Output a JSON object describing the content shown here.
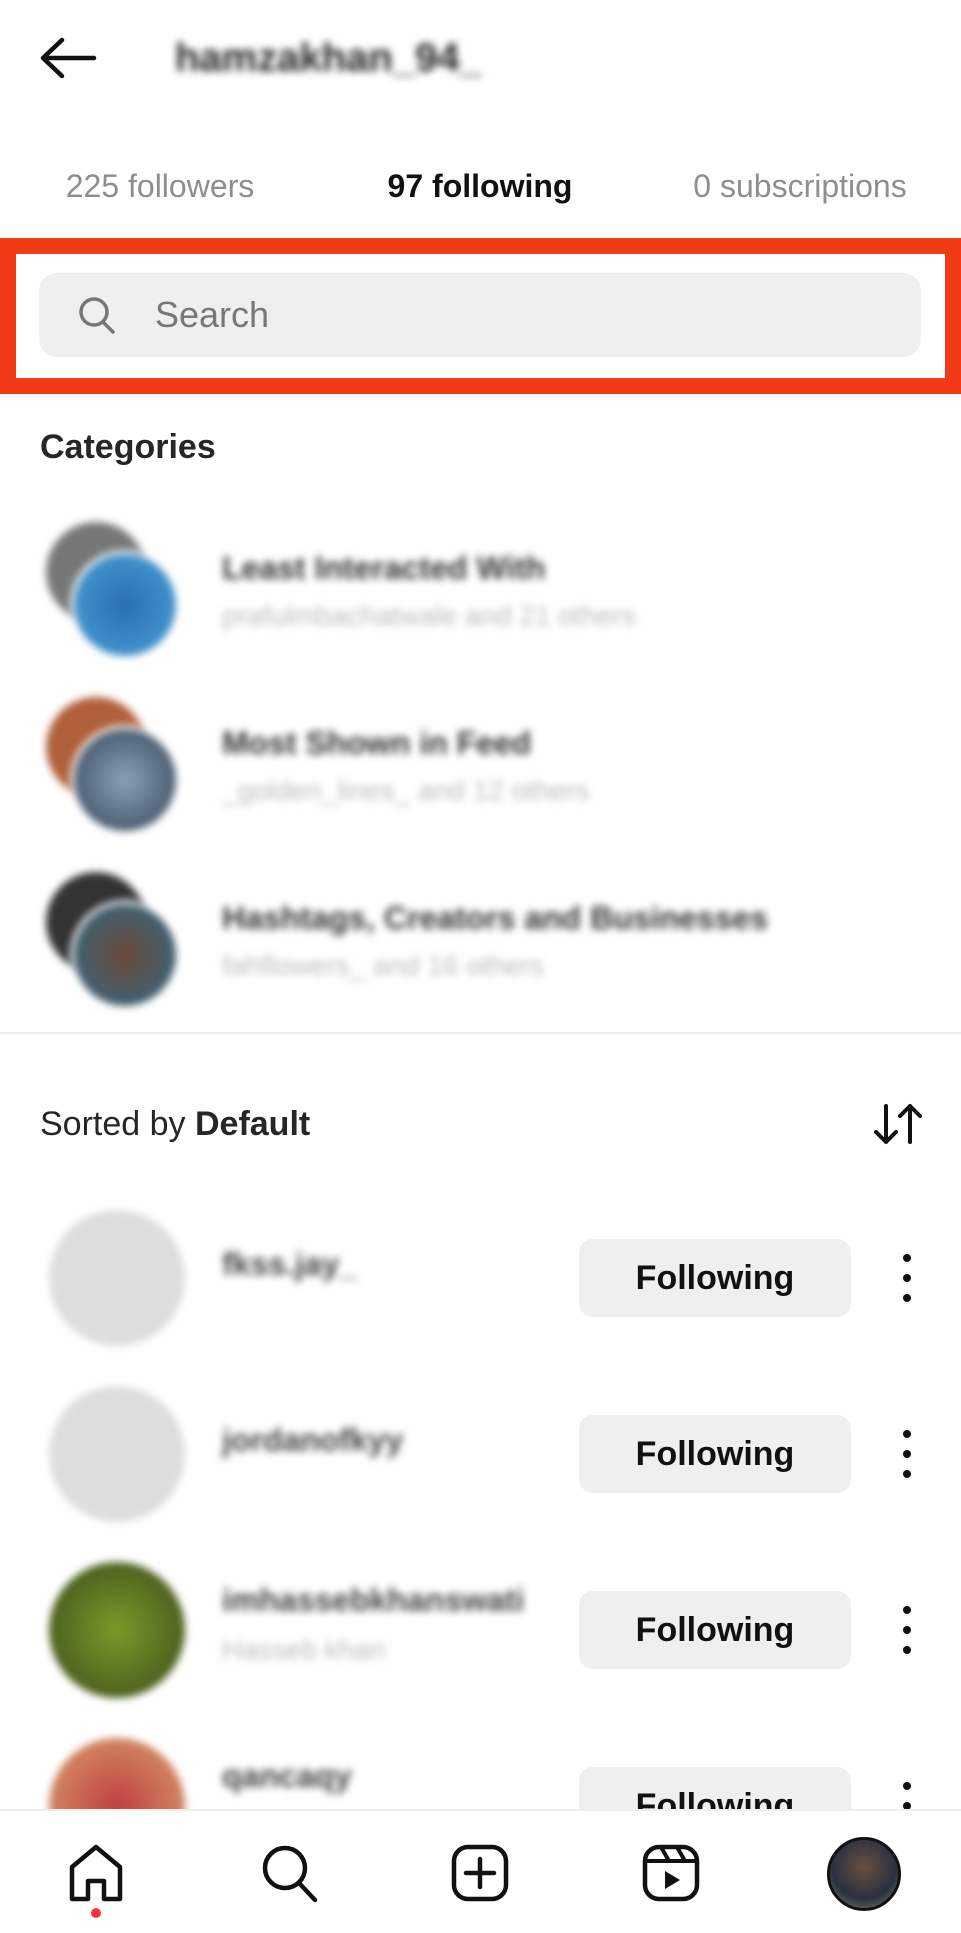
{
  "header": {
    "title": "hamzakhan_94_"
  },
  "tabs": [
    {
      "label": "225 followers",
      "active": false
    },
    {
      "label": "97 following",
      "active": true
    },
    {
      "label": "0 subscriptions",
      "active": false
    }
  ],
  "search": {
    "placeholder": "Search",
    "highlight_color": "#f23a18"
  },
  "categories": {
    "heading": "Categories",
    "items": [
      {
        "title": "Least Interacted With",
        "subtitle": "prafulmbachatwale and 21 others"
      },
      {
        "title": "Most Shown in Feed",
        "subtitle": "_golden_lines_ and 12 others"
      },
      {
        "title": "Hashtags, Creators and Businesses",
        "subtitle": "fahflowers_ and 16 others"
      }
    ]
  },
  "sort": {
    "prefix": "Sorted by ",
    "value": "Default"
  },
  "following": [
    {
      "username": "fkss.jay_",
      "name": "",
      "button": "Following"
    },
    {
      "username": "jordanofkyy",
      "name": "",
      "button": "Following"
    },
    {
      "username": "imhassebkhanswati",
      "name": "Hasseb khan",
      "button": "Following"
    },
    {
      "username": "qancaqy",
      "name": "",
      "button": "Following"
    }
  ],
  "nav": {
    "items": [
      "home",
      "search",
      "create",
      "reels",
      "profile"
    ],
    "notification_color": "#ff3040"
  }
}
